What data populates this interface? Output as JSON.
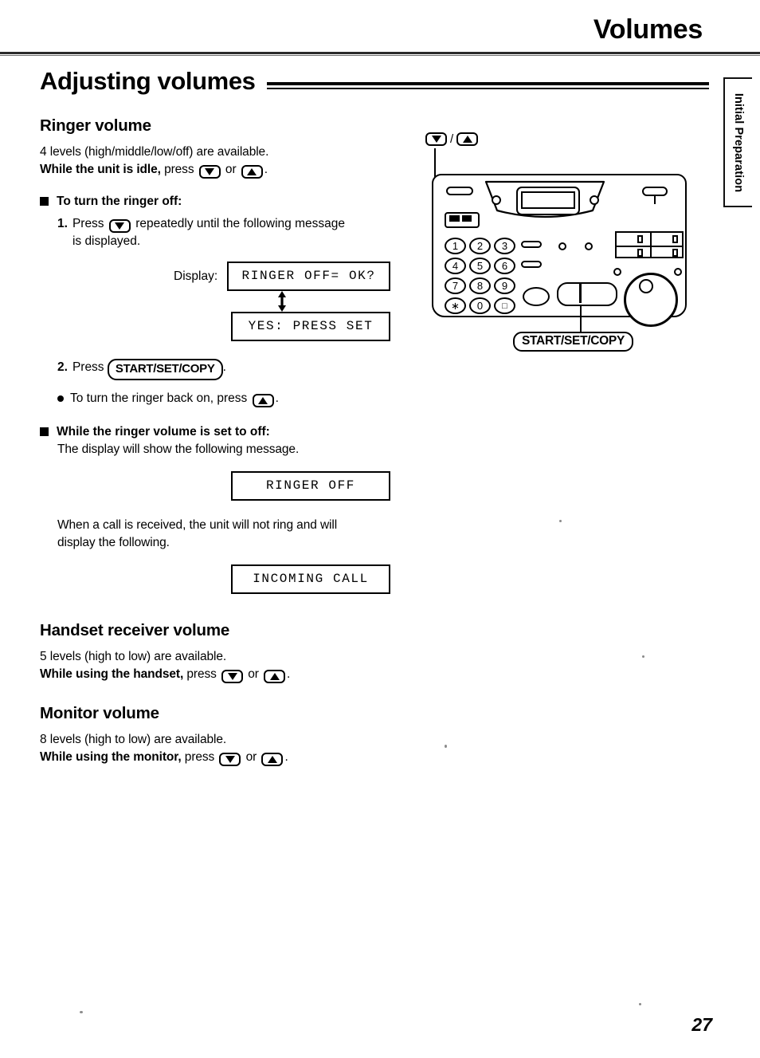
{
  "page": {
    "running_head": "Volumes",
    "folio": "27",
    "side_tab_label": "Initial Preparation",
    "main_heading": "Adjusting volumes"
  },
  "sections": {
    "ringer": {
      "heading": "Ringer volume",
      "line1": "4 levels (high/middle/low/off) are available.",
      "line2_bold": "While the unit is idle,",
      "line2_rest": "press",
      "line2_or": "or",
      "line2_end": ".",
      "turn_off": {
        "heading": "To turn the ringer off:",
        "step1_num": "1.",
        "step1_a": "Press",
        "step1_b": "repeatedly until the following message",
        "step1_c": "is displayed.",
        "display_label": "Display:",
        "display_1": "RINGER OFF= OK?",
        "display_2": "YES: PRESS SET",
        "step2_num": "2.",
        "step2_a": "Press",
        "step2_button": "START/SET/COPY",
        "step2_end": ".",
        "note_a": "To turn the ringer back on, press",
        "note_end": "."
      },
      "set_to_off": {
        "heading": "While the ringer volume is set to off:",
        "line1": "The display will show the following message.",
        "display_1": "RINGER OFF",
        "line2": "When a call is received, the unit will not ring and will",
        "line3": "display the following.",
        "display_2": "INCOMING CALL"
      }
    },
    "handset": {
      "heading": "Handset receiver volume",
      "line1": "5 levels (high to low) are available.",
      "line2_bold": "While using the handset,",
      "line2_rest": "press",
      "line2_or": "or",
      "line2_end": "."
    },
    "monitor": {
      "heading": "Monitor volume",
      "line1": "8 levels (high to low) are available.",
      "line2_bold": "While using the monitor,",
      "line2_rest": "press",
      "line2_or": "or",
      "line2_end": "."
    }
  },
  "diagram": {
    "callout_updown_sep": "/",
    "callout_startset": "START/SET/COPY",
    "keypad": [
      "1",
      "2",
      "3",
      "4",
      "5",
      "6",
      "7",
      "8",
      "9",
      "∗",
      "0",
      "□"
    ]
  },
  "icons": {
    "down_arrow": "down-arrow-key-icon",
    "up_arrow": "up-arrow-key-icon",
    "updown_arrow": "up-down-double-arrow-icon",
    "square_bullet": "filled-square-bullet-icon",
    "round_bullet": "filled-round-bullet-icon"
  },
  "colors": {
    "ink": "#000000",
    "rule": "#2b2b2b",
    "paper": "#ffffff"
  }
}
